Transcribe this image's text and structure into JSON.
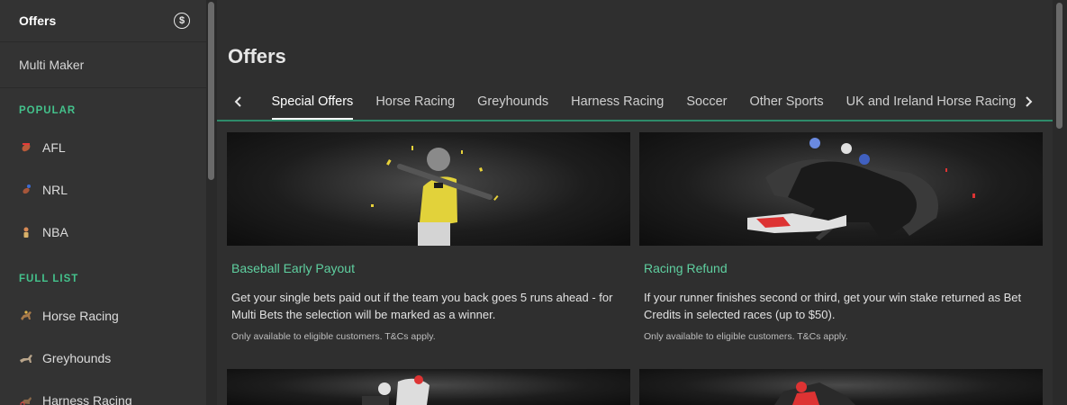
{
  "sidebar": {
    "offers_label": "Offers",
    "multi_maker_label": "Multi Maker",
    "popular_heading": "POPULAR",
    "popular": [
      {
        "label": "AFL",
        "icon": "afl-icon"
      },
      {
        "label": "NRL",
        "icon": "nrl-icon"
      },
      {
        "label": "NBA",
        "icon": "nba-icon"
      }
    ],
    "full_list_heading": "FULL LIST",
    "full_list": [
      {
        "label": "Horse Racing",
        "icon": "horse-racing-icon"
      },
      {
        "label": "Greyhounds",
        "icon": "greyhound-icon"
      },
      {
        "label": "Harness Racing",
        "icon": "harness-racing-icon"
      }
    ]
  },
  "main": {
    "title": "Offers",
    "tabs": [
      {
        "label": "Special Offers",
        "active": true
      },
      {
        "label": "Horse Racing"
      },
      {
        "label": "Greyhounds"
      },
      {
        "label": "Harness Racing"
      },
      {
        "label": "Soccer"
      },
      {
        "label": "Other Sports"
      },
      {
        "label": "UK and Ireland Horse Racing"
      }
    ],
    "cards": [
      {
        "title": "Baseball Early Payout",
        "description": "Get your single bets paid out if the team you back goes 5 runs ahead - for Multi Bets the selection will be marked as a winner.",
        "note": "Only available to eligible customers. T&Cs apply.",
        "image": "baseball-player-image"
      },
      {
        "title": "Racing Refund",
        "description": "If your runner finishes second or third, get your win stake returned as Bet Credits in selected races (up to $50).",
        "note": "Only available to eligible customers. T&Cs apply.",
        "image": "racing-horses-image"
      }
    ]
  },
  "colors": {
    "accent": "#44c28c",
    "card_title": "#5fd0a0",
    "background": "#2f2f2f",
    "sidebar": "#333333"
  }
}
